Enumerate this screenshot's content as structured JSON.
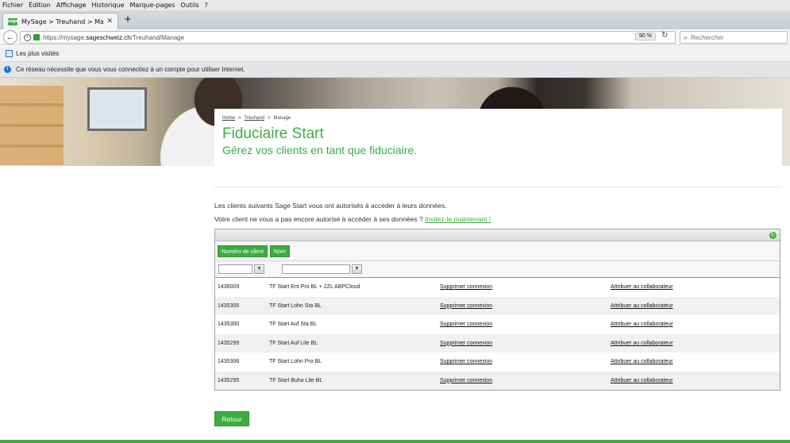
{
  "browser": {
    "menu": [
      "Fichier",
      "Édition",
      "Affichage",
      "Historique",
      "Marque-pages",
      "Outils",
      "?"
    ],
    "tab_title": "MySage > Treuhand > Mana",
    "favicon_text": "sage",
    "url_prefix": "https://mysage.",
    "url_domain": "sageschweiz.ch",
    "url_path": "/Treuhand/Manage",
    "zoom": "90 %",
    "search_placeholder": "Rechercher",
    "bookmark_label": "Les plus visités",
    "notification": "Ce réseau nécessite que vous vous connectiez à un compte pour utiliser Internet."
  },
  "page": {
    "breadcrumb": [
      "Home",
      "Treuhand",
      "Manage"
    ],
    "title": "Fiduciaire Start",
    "subtitle": "Gérez vos clients en tant que fiduciaire.",
    "intro": "Les clients suivants Sage Start vous ont autorisés à accéder à leurs données.",
    "invite_text": "Votre client ne vous a pas encore autorisé à accéder à ses données ?",
    "invite_link": "Invitez-le maintenant !",
    "back_button": "Retour"
  },
  "grid": {
    "columns": [
      "Numéro de client",
      "Nom"
    ],
    "rows": [
      {
        "number": "1436009",
        "name": "TF Start Ent Pro BL + 2ZL ABPCloud",
        "delete": "Supprimer connexion",
        "assign": "Attribuer au collaborateur"
      },
      {
        "number": "1435305",
        "name": "TF Start Lohn Sta BL",
        "delete": "Supprimer connexion",
        "assign": "Attribuer au collaborateur"
      },
      {
        "number": "1435300",
        "name": "TF Start Auf Sta BL",
        "delete": "Supprimer connexion",
        "assign": "Attribuer au collaborateur"
      },
      {
        "number": "1435299",
        "name": "TF Start Auf Lite BL",
        "delete": "Supprimer connexion",
        "assign": "Attribuer au collaborateur"
      },
      {
        "number": "1435306",
        "name": "TF Start Lohn Pro BL",
        "delete": "Supprimer connexion",
        "assign": "Attribuer au collaborateur"
      },
      {
        "number": "1435295",
        "name": "TF Start Buha Lite BL",
        "delete": "Supprimer connexion",
        "assign": "Attribuer au collaborateur"
      }
    ]
  },
  "colors": {
    "accent": "#3cad3f"
  },
  "icons": {
    "back": "back-arrow-icon",
    "reload": "reload-icon",
    "search": "search-icon",
    "refresh": "refresh-icon",
    "filter": "filter-icon"
  }
}
